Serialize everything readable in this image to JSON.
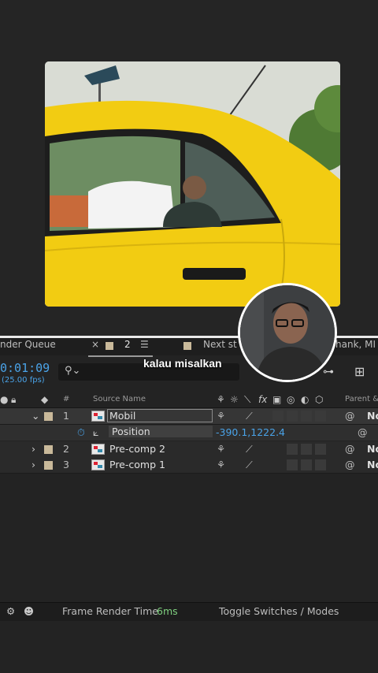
{
  "panel_tabs": {
    "render_queue": "nder Queue",
    "close": "×",
    "comp_number": "2",
    "menu_icon": "hamburger-icon",
    "next_tab": "Next st",
    "right_tab": "hank, MI"
  },
  "timeline": {
    "timecode": "0:01:09",
    "fps": "(25.00 fps)",
    "search_placeholder": ""
  },
  "columns": {
    "hash": "#",
    "source_name": "Source Name",
    "fx": "fx",
    "parent": "Parent &"
  },
  "layers": [
    {
      "index": "1",
      "name": "Mobil",
      "parent": "No",
      "expanded": true
    },
    {
      "index": "2",
      "name": "Pre-comp 2",
      "parent": "No",
      "expanded": false
    },
    {
      "index": "3",
      "name": "Pre-comp 1",
      "parent": "No",
      "expanded": false
    }
  ],
  "property": {
    "name": "Position",
    "value": "-390.1,1222.4"
  },
  "footer": {
    "frame_render_label": "Frame Render Time",
    "frame_render_value": "6ms",
    "toggle_label": "Toggle Switches / Modes"
  },
  "caption": "kalau misalkan",
  "colors": {
    "accent_blue": "#4aa3e8",
    "render_green": "#7fd07f",
    "label_tan": "#c9b99a",
    "car_yellow": "#f2cc12"
  }
}
